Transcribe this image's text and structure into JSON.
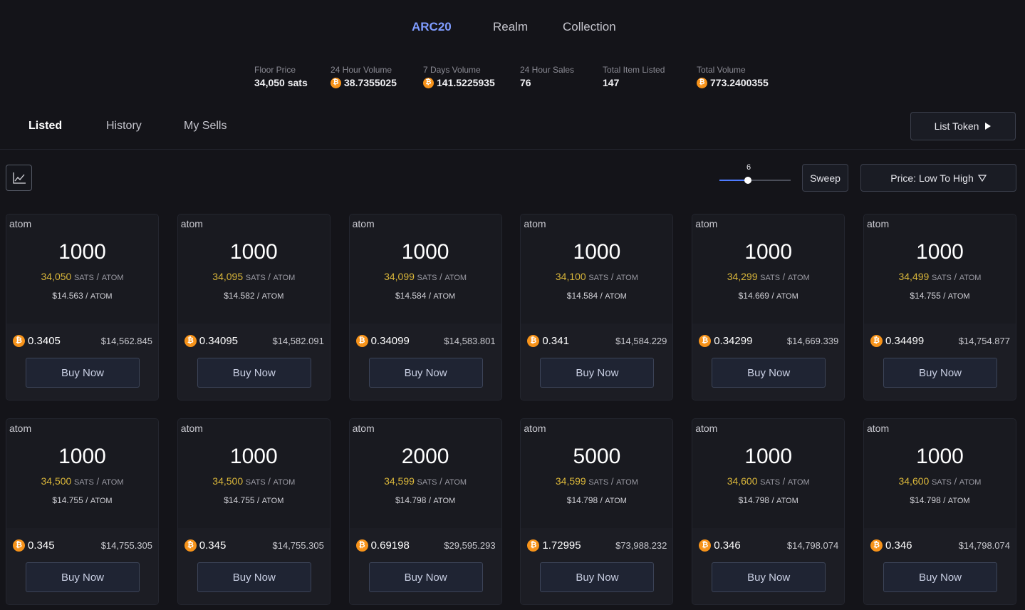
{
  "top_tabs": [
    "ARC20",
    "Realm",
    "Collection"
  ],
  "stats": [
    {
      "label": "Floor Price",
      "value": "34,050 sats",
      "btc": false
    },
    {
      "label": "24 Hour Volume",
      "value": "38.7355025",
      "btc": true
    },
    {
      "label": "7 Days Volume",
      "value": "141.5225935",
      "btc": true
    },
    {
      "label": "24 Hour Sales",
      "value": "76",
      "btc": false
    },
    {
      "label": "Total Item Listed",
      "value": "147",
      "btc": false
    },
    {
      "label": "Total Volume",
      "value": "773.2400355",
      "btc": true
    }
  ],
  "sub_tabs": [
    "Listed",
    "History",
    "My Sells"
  ],
  "list_token_label": "List Token",
  "slider": {
    "value": "6",
    "fraction": 0.4
  },
  "sweep_label": "Sweep",
  "sort_label": "Price: Low To High",
  "colors": {
    "accent": "#7f9cff",
    "gold": "#d8b53a",
    "btc": "#f7931a",
    "slider": "#4e7bff"
  },
  "cards": [
    {
      "ticker": "atom",
      "amount": "1000",
      "sats": "34,050",
      "sats_unit": "SATS",
      "unit": "ATOM",
      "usd_unit": "$14.563",
      "btc": "0.3405",
      "usd_total": "$14,562.845",
      "buy": "Buy Now"
    },
    {
      "ticker": "atom",
      "amount": "1000",
      "sats": "34,095",
      "sats_unit": "SATS",
      "unit": "ATOM",
      "usd_unit": "$14.582",
      "btc": "0.34095",
      "usd_total": "$14,582.091",
      "buy": "Buy Now"
    },
    {
      "ticker": "atom",
      "amount": "1000",
      "sats": "34,099",
      "sats_unit": "SATS",
      "unit": "ATOM",
      "usd_unit": "$14.584",
      "btc": "0.34099",
      "usd_total": "$14,583.801",
      "buy": "Buy Now"
    },
    {
      "ticker": "atom",
      "amount": "1000",
      "sats": "34,100",
      "sats_unit": "SATS",
      "unit": "ATOM",
      "usd_unit": "$14.584",
      "btc": "0.341",
      "usd_total": "$14,584.229",
      "buy": "Buy Now"
    },
    {
      "ticker": "atom",
      "amount": "1000",
      "sats": "34,299",
      "sats_unit": "SATS",
      "unit": "ATOM",
      "usd_unit": "$14.669",
      "btc": "0.34299",
      "usd_total": "$14,669.339",
      "buy": "Buy Now"
    },
    {
      "ticker": "atom",
      "amount": "1000",
      "sats": "34,499",
      "sats_unit": "SATS",
      "unit": "ATOM",
      "usd_unit": "$14.755",
      "btc": "0.34499",
      "usd_total": "$14,754.877",
      "buy": "Buy Now"
    },
    {
      "ticker": "atom",
      "amount": "1000",
      "sats": "34,500",
      "sats_unit": "SATS",
      "unit": "ATOM",
      "usd_unit": "$14.755",
      "btc": "0.345",
      "usd_total": "$14,755.305",
      "buy": "Buy Now"
    },
    {
      "ticker": "atom",
      "amount": "1000",
      "sats": "34,500",
      "sats_unit": "SATS",
      "unit": "ATOM",
      "usd_unit": "$14.755",
      "btc": "0.345",
      "usd_total": "$14,755.305",
      "buy": "Buy Now"
    },
    {
      "ticker": "atom",
      "amount": "2000",
      "sats": "34,599",
      "sats_unit": "SATS",
      "unit": "ATOM",
      "usd_unit": "$14.798",
      "btc": "0.69198",
      "usd_total": "$29,595.293",
      "buy": "Buy Now"
    },
    {
      "ticker": "atom",
      "amount": "5000",
      "sats": "34,599",
      "sats_unit": "SATS",
      "unit": "ATOM",
      "usd_unit": "$14.798",
      "btc": "1.72995",
      "usd_total": "$73,988.232",
      "buy": "Buy Now"
    },
    {
      "ticker": "atom",
      "amount": "1000",
      "sats": "34,600",
      "sats_unit": "SATS",
      "unit": "ATOM",
      "usd_unit": "$14.798",
      "btc": "0.346",
      "usd_total": "$14,798.074",
      "buy": "Buy Now"
    },
    {
      "ticker": "atom",
      "amount": "1000",
      "sats": "34,600",
      "sats_unit": "SATS",
      "unit": "ATOM",
      "usd_unit": "$14.798",
      "btc": "0.346",
      "usd_total": "$14,798.074",
      "buy": "Buy Now"
    }
  ]
}
